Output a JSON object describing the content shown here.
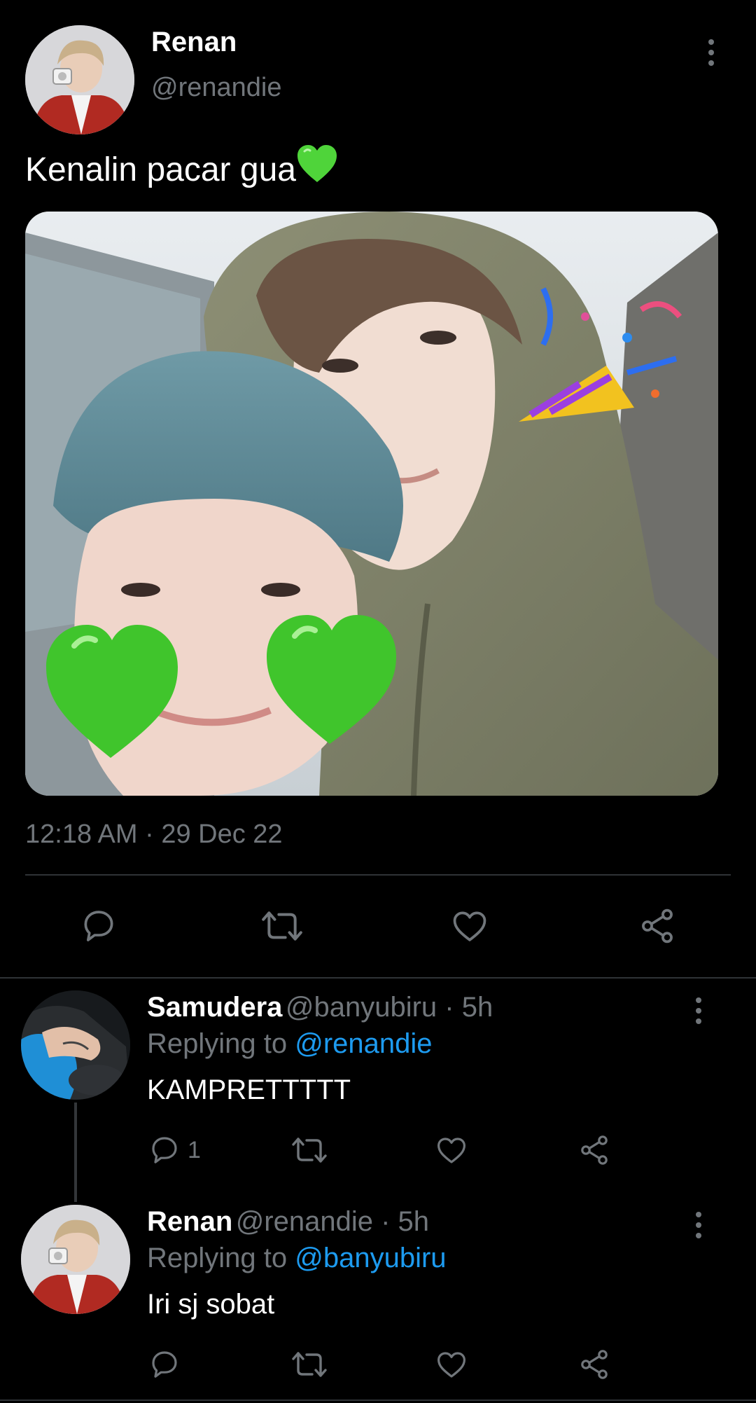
{
  "main_tweet": {
    "author_name": "Renan",
    "author_handle": "@renandie",
    "text": "Kenalin pacar gua",
    "timestamp": "12:18 AM · 29 Dec 22",
    "icons": {
      "reply": "reply-icon",
      "retweet": "retweet-icon",
      "like": "heart-icon",
      "share": "share-icon",
      "more": "more-vertical-icon"
    }
  },
  "replies": [
    {
      "author_name": "Samudera",
      "meta": "@banyubiru · 5h",
      "replying_prefix": "Replying to",
      "replying_mention": "@renandie",
      "text": "KAMPRETTTTT",
      "reply_count": "1"
    },
    {
      "author_name": "Renan",
      "meta": "@renandie · 5h",
      "replying_prefix": "Replying to",
      "replying_mention": "@banyubiru",
      "text": "Iri sj sobat",
      "reply_count": ""
    }
  ],
  "colors": {
    "background": "#000000",
    "secondary_text": "#71767b",
    "mention": "#1d9bf0",
    "emoji_green": "#4fd43a"
  }
}
